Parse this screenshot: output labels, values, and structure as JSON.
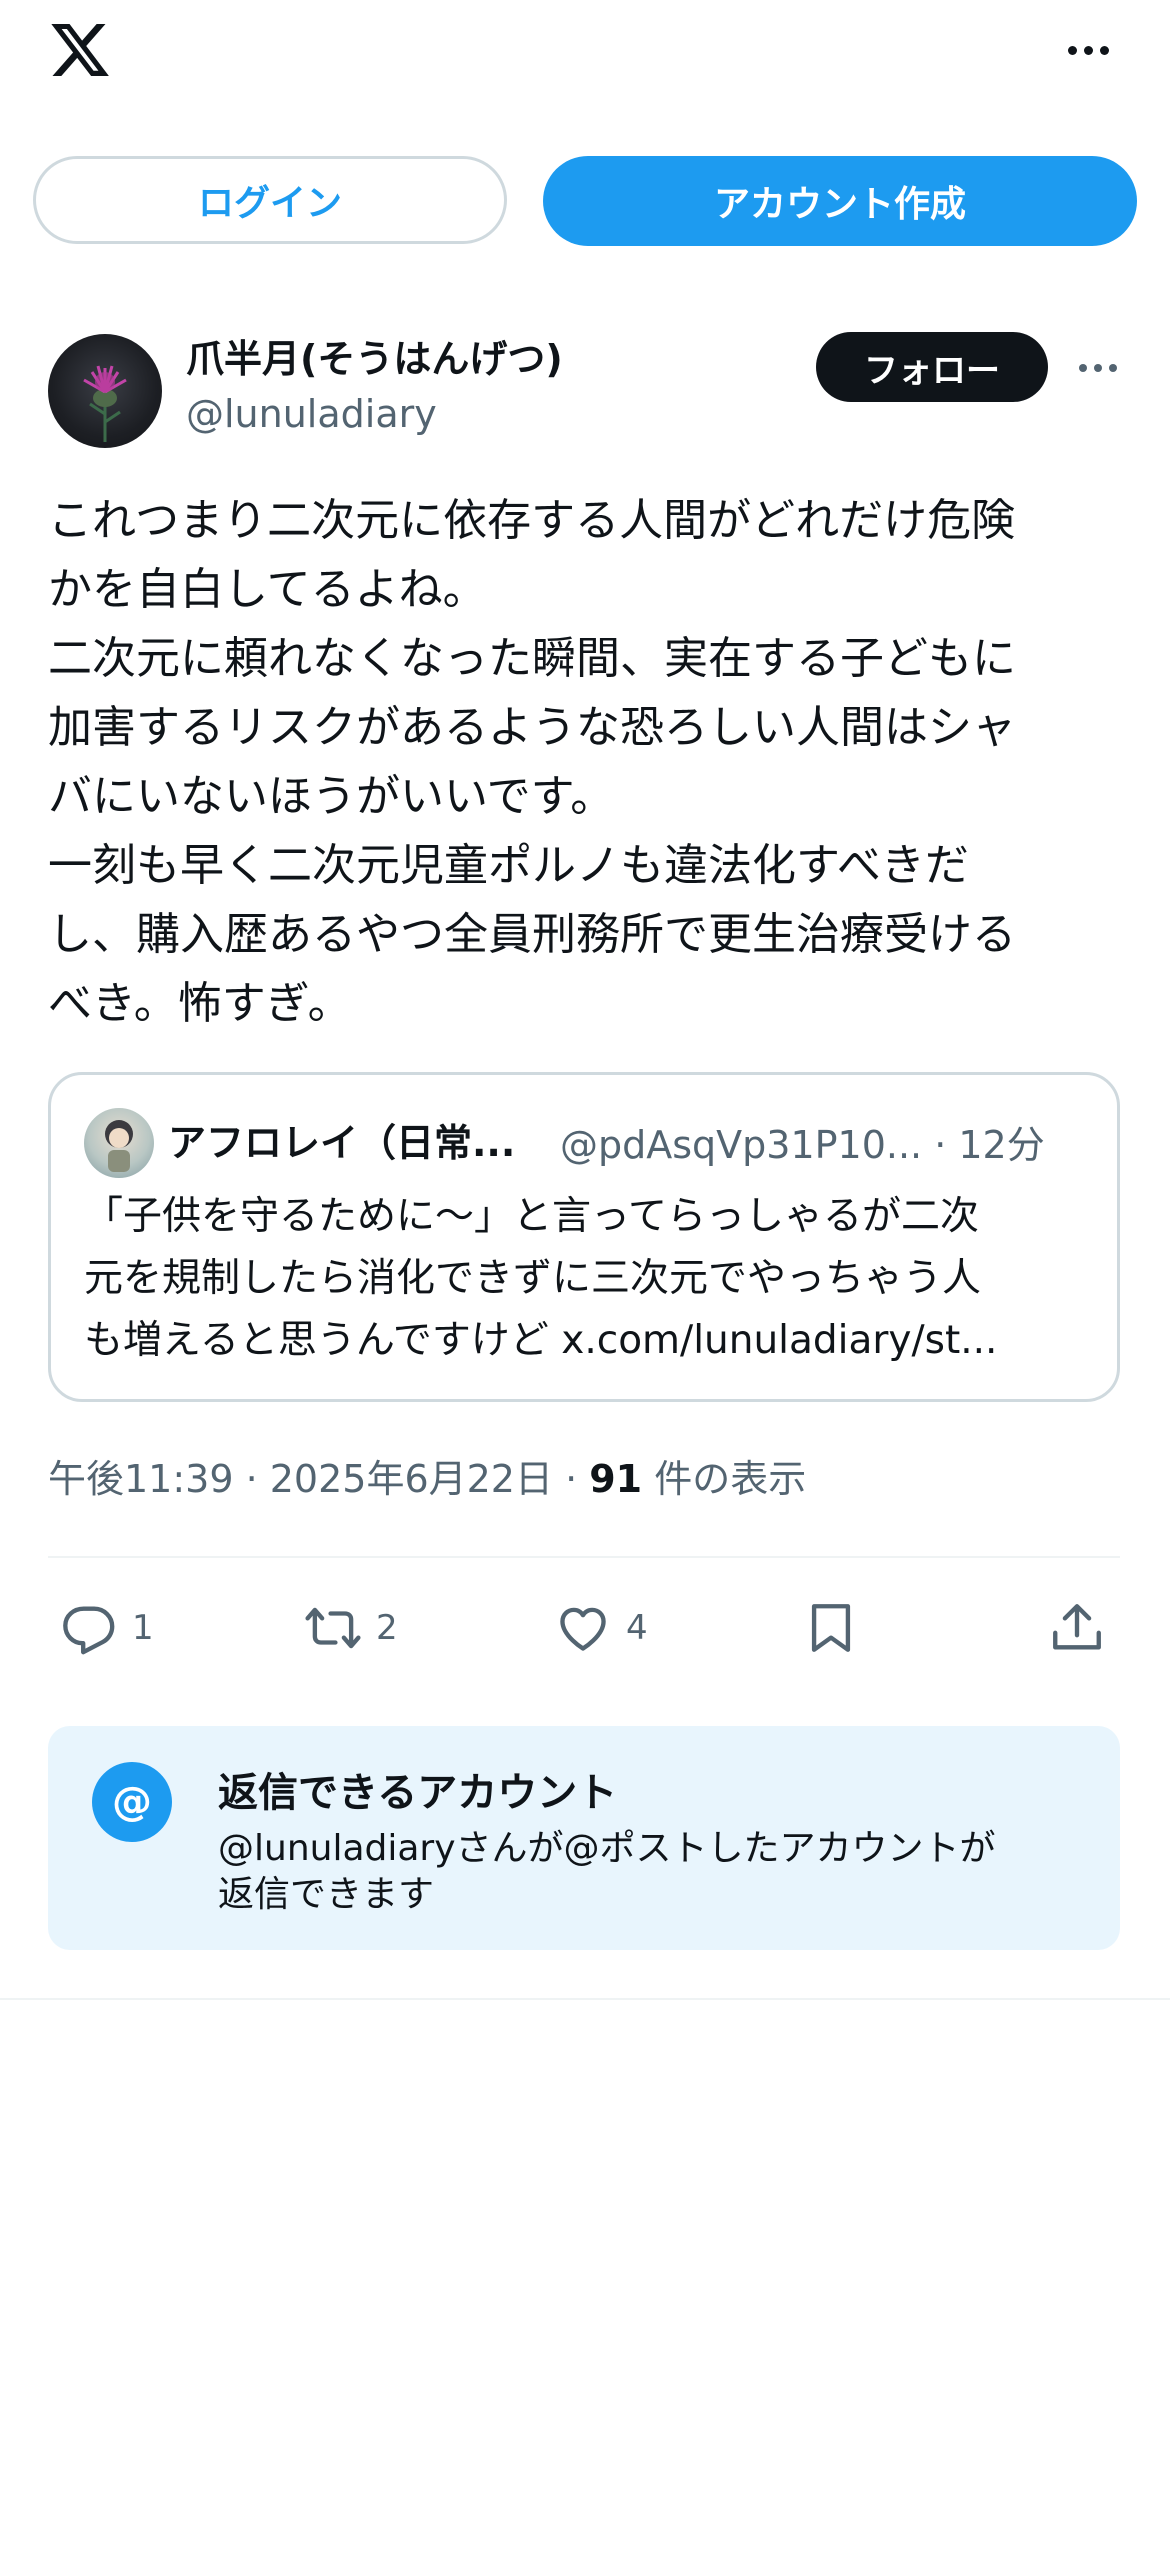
{
  "header": {
    "logo_icon": "x-logo-icon",
    "more_icon": "more-horizontal-icon"
  },
  "auth": {
    "login_label": "ログイン",
    "signup_label": "アカウント作成"
  },
  "post": {
    "author_name": "爪半月(そうはんげつ)",
    "author_handle": "@lunuladiary",
    "follow_label": "フォロー",
    "text": "これつまり二次元に依存する人間がどれだけ危険\nかを自白してるよね。\n二次元に頼れなくなった瞬間、実在する子どもに\n加害するリスクがあるような恐ろしい人間はシャ\nバにいないほうがいいです。\n一刻も早く二次元児童ポルノも違法化すべきだ\nし、購入歴あるやつ全員刑務所で更生治療受ける\nべき。怖すぎ。",
    "quote": {
      "name": "アフロレイ（日常...",
      "handle_time": "@pdAsqVp31P10... · 12分",
      "text": "「子供を守るために〜」と言ってらっしゃるが二次\n元を規制したら消化できずに三次元でやっちゃう人\nも増えると思うんですけど x.com/lunuladiary/st..."
    },
    "time": "午後11:39 · 2025年6月22日 · ",
    "views_count": "91",
    "views_label": " 件の表示",
    "actions": {
      "reply_count": "1",
      "repost_count": "2",
      "like_count": "4"
    }
  },
  "reply_restriction": {
    "icon": "@",
    "title": "返信できるアカウント",
    "description": "@lunuladiaryさんが@ポストしたアカウントが\n返信できます"
  },
  "colors": {
    "accent": "#1d9bf0",
    "text": "#0f1419",
    "secondary": "#536471",
    "border": "#cfd9de",
    "reply_box_bg": "#e8f5fd"
  }
}
